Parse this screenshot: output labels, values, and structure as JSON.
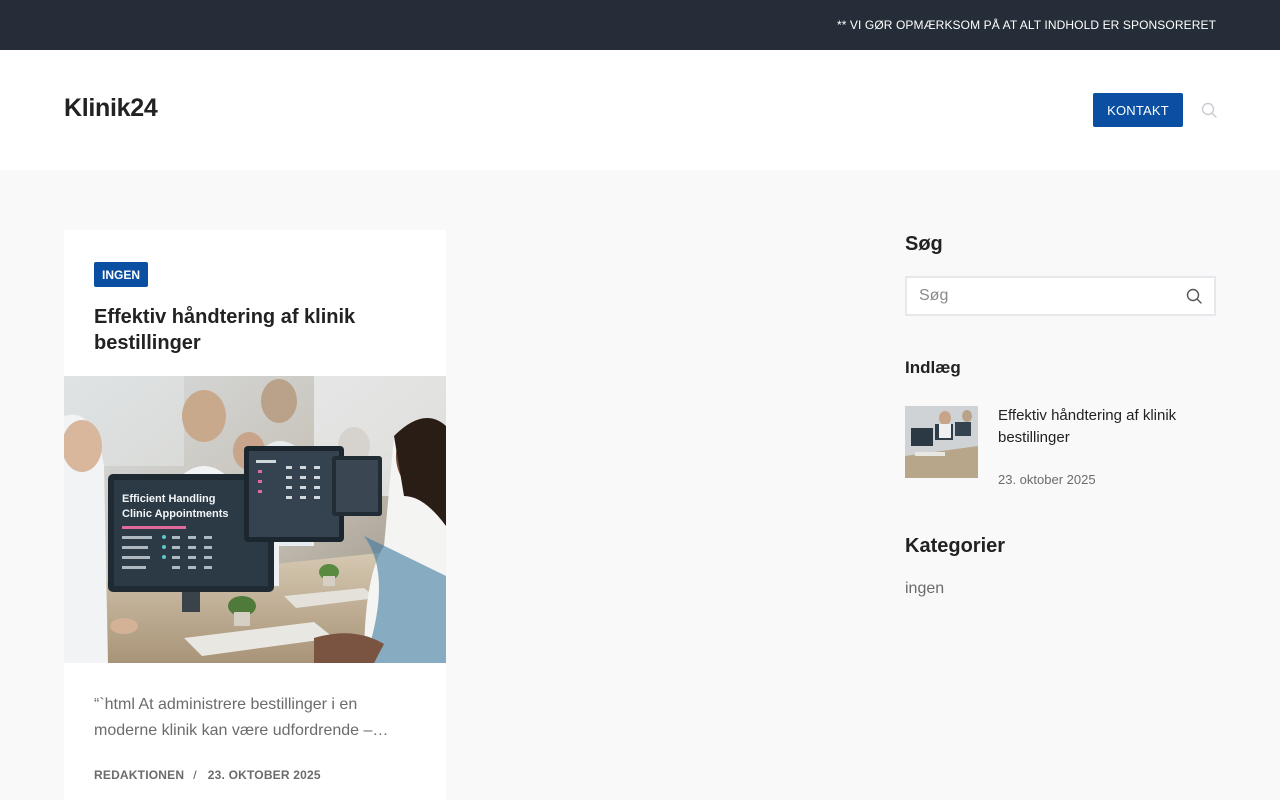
{
  "topbar": {
    "notice": "** VI GØR OPMÆRKSOM PÅ AT ALT INDHOLD ER SPONSORERET"
  },
  "header": {
    "logo": "Klinik24",
    "contact_label": "KONTAKT",
    "search_icon": "search-icon"
  },
  "article": {
    "category": "INGEN",
    "title": "Effektiv håndtering af klinik bestillinger",
    "image_text": {
      "line1": "Efficient Handling",
      "line2": "Clinic Appointments"
    },
    "excerpt": "“`html At administrere bestillinger i en moderne klinik kan være udfordrende –…",
    "author": "REDAKTIONEN",
    "separator": "/",
    "date": "23. OKTOBER 2025"
  },
  "sidebar": {
    "search_heading": "Søg",
    "search_placeholder": "Søg",
    "posts_heading": "Indlæg",
    "posts": [
      {
        "title": "Effektiv håndtering af klinik bestillinger",
        "date": "23. oktober 2025"
      }
    ],
    "categories_heading": "Kategorier",
    "categories": [
      "ingen"
    ]
  },
  "colors": {
    "topbar": "#252e38",
    "accent": "#0a4fa1",
    "background": "#f9f9f9"
  }
}
